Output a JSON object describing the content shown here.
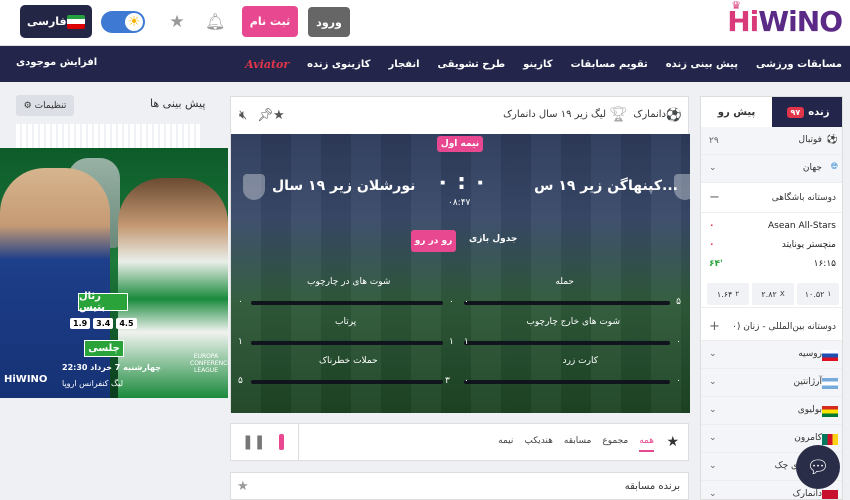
{
  "header": {
    "logo_hi": "Hi",
    "logo_wino": "WiNO",
    "login_label": "ورود",
    "register_label": "ثبت نام",
    "language_label": "فارسی"
  },
  "nav": {
    "items": [
      "مسابقات ورزشی",
      "پیش بینی زنده",
      "تقویم مسابقات",
      "کازینو",
      "طرح تشویقی",
      "انفجار",
      "کازینوی زنده",
      "Aviator"
    ],
    "deposit_label": "افزایش موجودی"
  },
  "left": {
    "title": "پیش بینی ها",
    "settings_label": "تنظیمات",
    "promo": {
      "team_a": "رئال بتیس",
      "team_b": "چلسی",
      "odds": [
        "4.5",
        "3.4",
        "1.9"
      ],
      "date": "چهارشنبه 7 خرداد",
      "time": "22:30",
      "league": "لیگ کنفرانس اروپا",
      "logo": "HiWINO",
      "conference": "EUROPA CONFERENCE LEAGUE"
    }
  },
  "match": {
    "country": "دانمارک",
    "league": "لیگ زیر ۱۹ سال دانمارک",
    "half_badge": "نیمه اول",
    "home": "کپنهاگن زیر ۱۹ س...",
    "away": "نورشلان زیر ۱۹ سال",
    "score": "۰ : ۰",
    "timer": "۰۸:۴۷",
    "live_button": "رو در رو",
    "table_button": "جدول بازی",
    "stats": [
      {
        "label": "حمله",
        "home": "۵",
        "away": "۰"
      },
      {
        "label": "شوت های در چارچوب",
        "home": "۰",
        "away": "۰"
      },
      {
        "label": "شوت های خارج چارچوب",
        "home": "۰",
        "away": "۱"
      },
      {
        "label": "پرتاب",
        "home": "۱",
        "away": "۱"
      },
      {
        "label": "کارت زرد",
        "home": "۰",
        "away": "۰"
      },
      {
        "label": "حملات خطرناک",
        "home": "۳",
        "away": "۵"
      }
    ]
  },
  "tabs": [
    "همه",
    "مجموع",
    "مسابقه",
    "هندیکپ",
    "نیمه"
  ],
  "winner_title": "برنده مسابقه",
  "right": {
    "tab_pre": "پیش رو",
    "tab_live": "زنده",
    "live_count": "۹۷",
    "sport": {
      "label": "فوتبال",
      "count": "۲۹"
    },
    "region": "جهان",
    "category": "دوستانه باشگاهی",
    "match": {
      "team1": "Asean All-Stars",
      "team2": "منچستر یونایتد",
      "score1": "۰",
      "score2": "۰",
      "time": "۱۶:۱۵",
      "minute": "۶۴'",
      "odds": [
        {
          "k": "۱",
          "v": "۱۰.۵۲"
        },
        {
          "k": "X",
          "v": "۲.۸۲"
        },
        {
          "k": "۲",
          "v": "۱.۶۴"
        }
      ]
    },
    "category2": "دوستانه بین‌المللی - زنان (۰",
    "countries": [
      "روسیه",
      "آرژانتین",
      "بولیوی",
      "کامرون",
      "جمهوری چک",
      "دانمارک"
    ]
  },
  "colors": {
    "brand_pink": "#e8488f",
    "nav_navy": "#23264a",
    "live_red": "#e2354a"
  }
}
